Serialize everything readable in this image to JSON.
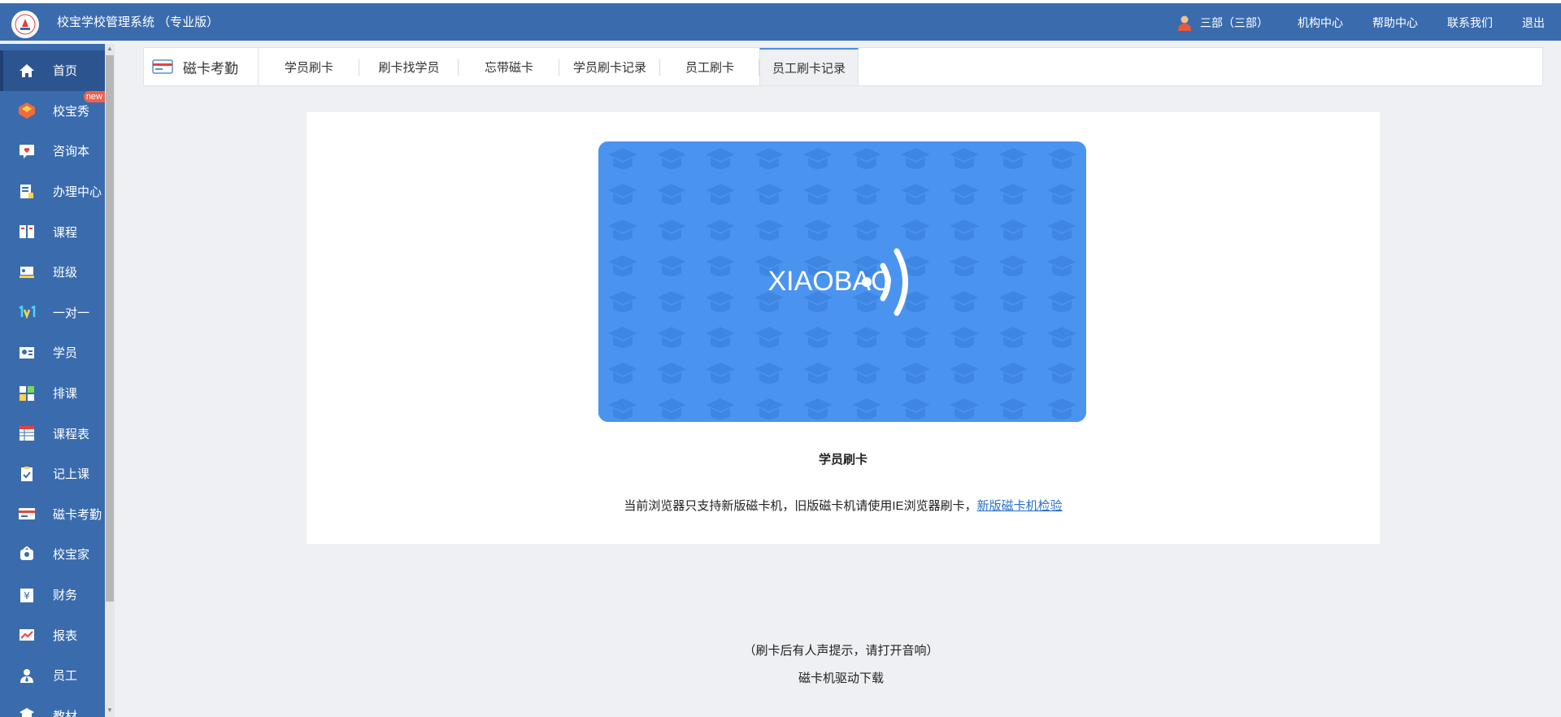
{
  "header": {
    "app_title": "校宝学校管理系统 （专业版）",
    "user": "三部（三部）",
    "nav": [
      "机构中心",
      "帮助中心",
      "联系我们",
      "退出"
    ]
  },
  "sidebar": {
    "items": [
      {
        "label": "首页",
        "icon": "home-icon",
        "active": true
      },
      {
        "label": "校宝秀",
        "icon": "xiaobao-show-icon",
        "badge": "new"
      },
      {
        "label": "咨询本",
        "icon": "consult-icon"
      },
      {
        "label": "办理中心",
        "icon": "handling-icon"
      },
      {
        "label": "课程",
        "icon": "course-icon"
      },
      {
        "label": "班级",
        "icon": "class-icon"
      },
      {
        "label": "一对一",
        "icon": "one-on-one-icon"
      },
      {
        "label": "学员",
        "icon": "student-icon"
      },
      {
        "label": "排课",
        "icon": "schedule-icon"
      },
      {
        "label": "课程表",
        "icon": "timetable-icon"
      },
      {
        "label": "记上课",
        "icon": "record-class-icon"
      },
      {
        "label": "磁卡考勤",
        "icon": "card-attendance-icon"
      },
      {
        "label": "校宝家",
        "icon": "xiaobao-home-icon"
      },
      {
        "label": "财务",
        "icon": "finance-icon"
      },
      {
        "label": "报表",
        "icon": "report-icon"
      },
      {
        "label": "员工",
        "icon": "staff-icon"
      },
      {
        "label": "教材",
        "icon": "textbook-icon"
      }
    ]
  },
  "module": {
    "title": "磁卡考勤",
    "tabs": [
      {
        "label": "学员刷卡",
        "active": false
      },
      {
        "label": "刷卡找学员",
        "active": false
      },
      {
        "label": "忘带磁卡",
        "active": false
      },
      {
        "label": "学员刷卡记录",
        "active": false
      },
      {
        "label": "员工刷卡",
        "active": false
      },
      {
        "label": "员工刷卡记录",
        "active": true
      }
    ]
  },
  "card": {
    "brand": "XIAOBAO",
    "color": "#4a94f0"
  },
  "main": {
    "title": "学员刷卡",
    "note_text": "当前浏览器只支持新版磁卡机，旧版磁卡机请使用IE浏览器刷卡，",
    "note_link": "新版磁卡机检验",
    "hint": "（刷卡后有人声提示，请打开音响）",
    "driver_link": "磁卡机驱动下载"
  },
  "colors": {
    "topbar": "#3a6cad",
    "accent": "#4a90e2",
    "link": "#2a6fc9",
    "badge": "#f0604d"
  }
}
